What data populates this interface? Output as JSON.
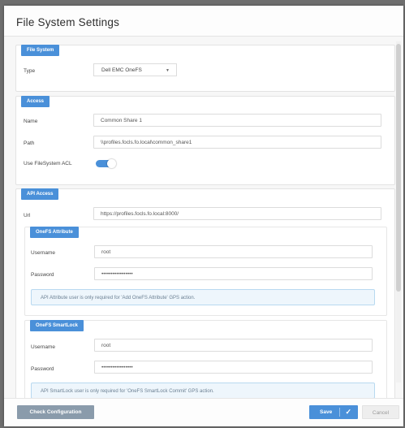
{
  "dialog": {
    "title": "File System Settings"
  },
  "file_system": {
    "tag": "File System",
    "type_label": "Type",
    "type_value": "Dell EMC OneFS"
  },
  "access": {
    "tag": "Access",
    "name_label": "Name",
    "name_value": "Common Share 1",
    "path_label": "Path",
    "path_value": "\\\\profiles.focls.fo.local\\common_share1",
    "acl_label": "Use FileSystem ACL",
    "acl_enabled": true
  },
  "api_access": {
    "tag": "API Access",
    "url_label": "Url",
    "url_value": "https://profiles.focls.fo.local:8000/",
    "attribute": {
      "tag": "OneFS Attribute",
      "username_label": "Username",
      "username_value": "root",
      "password_label": "Password",
      "password_value": "•••••••••••••••••",
      "info": "API Attribute user is only required for 'Add OneFS Attribute' GPS action."
    },
    "smartlock": {
      "tag": "OneFS SmartLock",
      "username_label": "Username",
      "username_value": "root",
      "password_label": "Password",
      "password_value": "•••••••••••••••••",
      "info": "API SmartLock user is only required for 'OneFS SmartLock Commit' GPS action."
    }
  },
  "footer": {
    "check_label": "Check Configuration",
    "save_label": "Save",
    "cancel_label": "Cancel"
  },
  "icons": {
    "select_caret": "chevron-down-icon",
    "save_check": "check-icon"
  },
  "colors": {
    "accent": "#4a90d9",
    "secondary_button": "#8a9bab"
  }
}
